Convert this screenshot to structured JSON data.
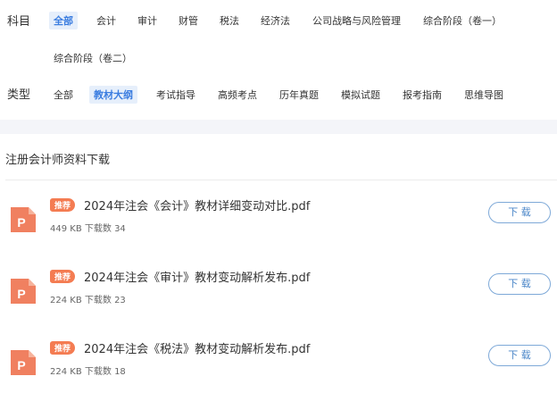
{
  "subject": {
    "label": "科目",
    "chips": [
      {
        "label": "全部",
        "active": true
      },
      {
        "label": "会计",
        "active": false
      },
      {
        "label": "审计",
        "active": false
      },
      {
        "label": "财管",
        "active": false
      },
      {
        "label": "税法",
        "active": false
      },
      {
        "label": "经济法",
        "active": false
      },
      {
        "label": "公司战略与风险管理",
        "active": false
      },
      {
        "label": "综合阶段（卷一）",
        "active": false
      },
      {
        "label": "综合阶段（卷二）",
        "active": false
      }
    ]
  },
  "type": {
    "label": "类型",
    "chips": [
      {
        "label": "全部",
        "active": false
      },
      {
        "label": "教材大纲",
        "active": true
      },
      {
        "label": "考试指导",
        "active": false
      },
      {
        "label": "高频考点",
        "active": false
      },
      {
        "label": "历年真题",
        "active": false
      },
      {
        "label": "模拟试题",
        "active": false
      },
      {
        "label": "报考指南",
        "active": false
      },
      {
        "label": "思维导图",
        "active": false
      }
    ]
  },
  "section_title": "注册会计师资料下载",
  "files": [
    {
      "tag": "推荐",
      "name": "2024年注会《会计》教材详细变动对比.pdf",
      "size": "449 KB",
      "downloads_label": "下载数",
      "downloads": "34",
      "button": "下 载",
      "icon_letter": "P"
    },
    {
      "tag": "推荐",
      "name": "2024年注会《审计》教材变动解析发布.pdf",
      "size": "224 KB",
      "downloads_label": "下载数",
      "downloads": "23",
      "button": "下 载",
      "icon_letter": "P"
    },
    {
      "tag": "推荐",
      "name": "2024年注会《税法》教材变动解析发布.pdf",
      "size": "224 KB",
      "downloads_label": "下载数",
      "downloads": "18",
      "button": "下 载",
      "icon_letter": "P"
    }
  ],
  "colors": {
    "accent": "#3b7de0",
    "active_chip_bg": "#e6effb",
    "tag": "#f47c52",
    "pdf_icon": "#f08060",
    "button_border": "#7ea9d8"
  }
}
